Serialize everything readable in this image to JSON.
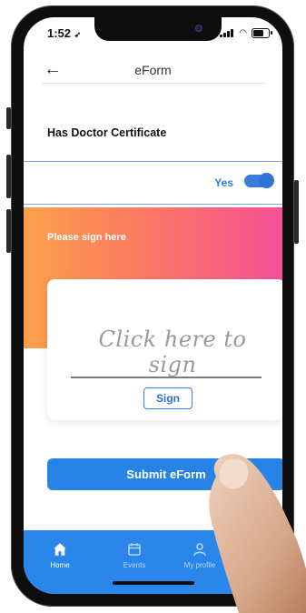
{
  "status": {
    "time": "1:52"
  },
  "header": {
    "title": "eForm"
  },
  "form": {
    "field_label": "Has Doctor Certificate",
    "toggle_label": "Yes",
    "toggle_value": true
  },
  "signature": {
    "prompt": "Please sign here",
    "placeholder": "Click here to sign",
    "sign_button": "Sign"
  },
  "actions": {
    "submit": "Submit eForm"
  },
  "tabs": [
    {
      "label": "Home",
      "icon": "home-icon"
    },
    {
      "label": "Events",
      "icon": "calendar-icon"
    },
    {
      "label": "My profile",
      "icon": "user-icon"
    }
  ],
  "colors": {
    "primary_blue": "#2784e6",
    "gradient_start": "#fca04b",
    "gradient_end": "#f55196"
  }
}
